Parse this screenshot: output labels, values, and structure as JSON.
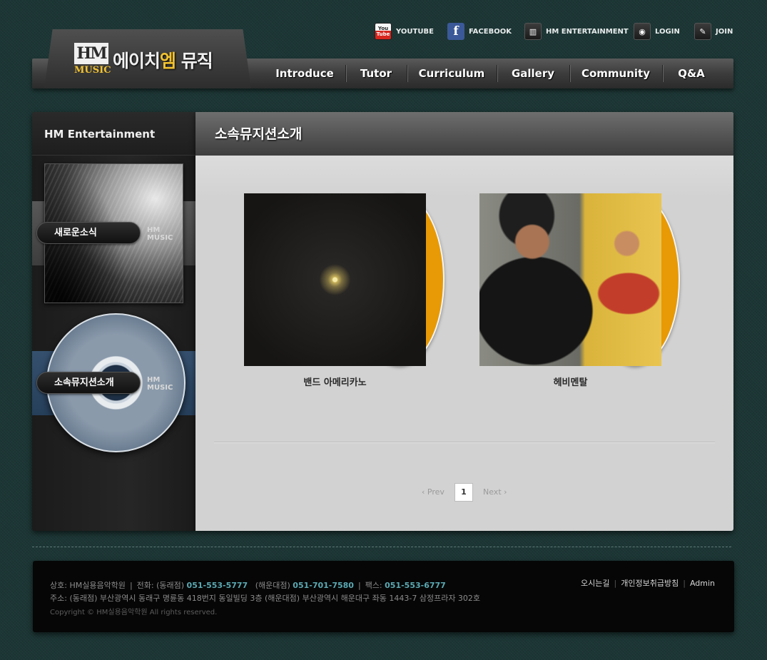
{
  "top_links": [
    {
      "label": "YOUTUBE",
      "icon": "youtube-icon"
    },
    {
      "label": "FACEBOOK",
      "icon": "facebook-icon"
    },
    {
      "label": "HM ENTERTAINMENT",
      "icon": "piano-icon"
    },
    {
      "label": "LOGIN",
      "icon": "login-icon"
    },
    {
      "label": "JOIN",
      "icon": "pencil-icon"
    }
  ],
  "logo": {
    "mark_top": "HM",
    "mark_bottom": "MUSIC",
    "text_a": "에이치",
    "text_b": "엠",
    "text_c": " 뮤직"
  },
  "nav": [
    "Introduce",
    "Tutor",
    "Curriculum",
    "Gallery",
    "Community",
    "Q&A"
  ],
  "side": {
    "title": "HM Entertainment",
    "items": [
      {
        "label": "새로운소식",
        "mark": "HM MUSIC"
      },
      {
        "label": "소속뮤지션소개",
        "mark": "HM MUSIC"
      }
    ]
  },
  "main": {
    "title": "소속뮤지션소개",
    "musicians": [
      {
        "name": "밴드 아메리카노"
      },
      {
        "name": "헤비멘탈"
      }
    ],
    "pager": {
      "prev": "‹ Prev",
      "page": "1",
      "next": "Next ›"
    }
  },
  "footer": {
    "line1_a": "상호: HM실용음악학원",
    "line1_b": "전화: (동래점)",
    "phone1": "051-553-5777",
    "line1_c": "(해운대점)",
    "phone2": "051-701-7580",
    "line1_d": "팩스:",
    "fax": "051-553-6777",
    "line2": "주소: (동래점) 부산광역시 동래구 명륜동 418번지 동일빌딩 3층   (해운대점) 부산광역시 해운대구 좌동 1443-7 삼정프라자 302호",
    "copyright": "Copyright © HM실용음악학원  All rights reserved.",
    "links": [
      "오시는길",
      "개인정보취급방침",
      "Admin"
    ]
  },
  "colors": {
    "accent": "#f2c230",
    "disc": "#e79a05",
    "phone": "#5ba9b3",
    "background": "#1c3635"
  }
}
